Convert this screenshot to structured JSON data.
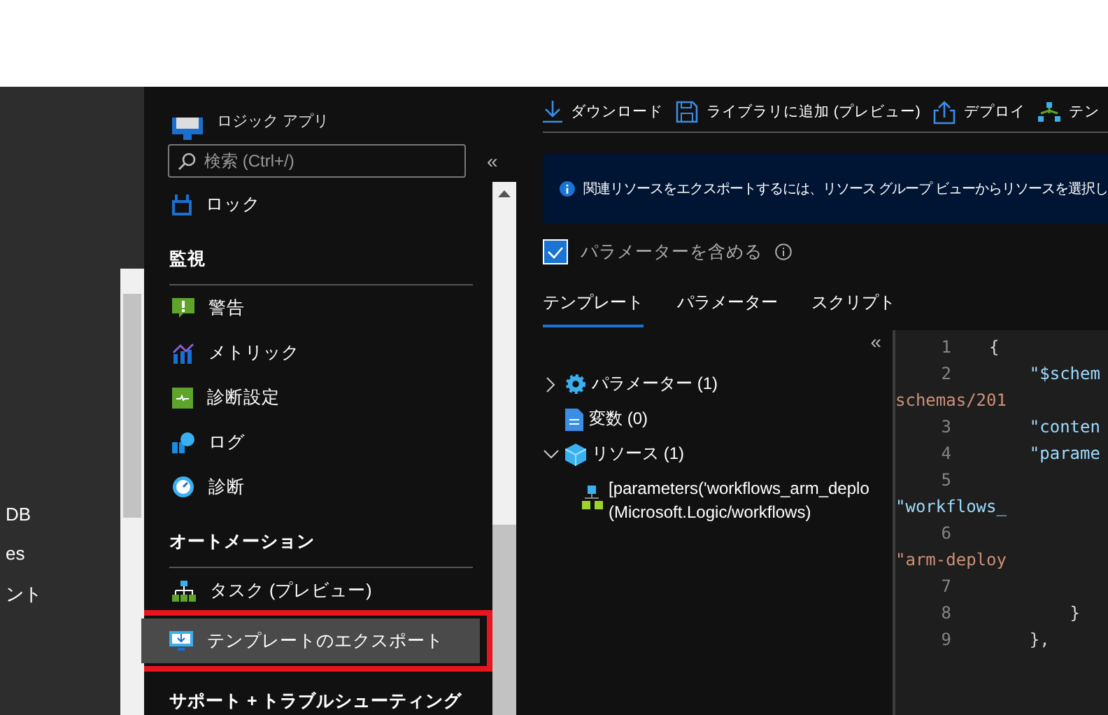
{
  "background_list": [
    {
      "label": "DB"
    },
    {
      "label": "es"
    },
    {
      "label": "ント"
    }
  ],
  "blade": {
    "subtitle": "ロジック アプリ",
    "search": {
      "placeholder": "検索 (Ctrl+/)"
    },
    "collapse": "«",
    "menu": [
      {
        "kind": "item",
        "label": "ロック",
        "selected": false
      },
      {
        "kind": "section",
        "label": "監視"
      },
      {
        "kind": "item",
        "label": "警告",
        "selected": false
      },
      {
        "kind": "item",
        "label": "メトリック",
        "selected": false
      },
      {
        "kind": "item",
        "label": "診断設定",
        "selected": false
      },
      {
        "kind": "item",
        "label": "ログ",
        "selected": false
      },
      {
        "kind": "item",
        "label": "診断",
        "selected": false
      },
      {
        "kind": "section",
        "label": "オートメーション"
      },
      {
        "kind": "item",
        "label": "タスク (プレビュー)",
        "selected": false
      },
      {
        "kind": "item",
        "label": "テンプレートのエクスポート",
        "selected": true
      },
      {
        "kind": "section",
        "label": "サポート + トラブルシューティング"
      }
    ]
  },
  "toolbar": [
    {
      "label": "ダウンロード"
    },
    {
      "label": "ライブラリに追加 (プレビュー)"
    },
    {
      "label": "デプロイ"
    },
    {
      "label": "テン"
    }
  ],
  "banner": {
    "text": "関連リソースをエクスポートするには、リソース グループ ビューからリソースを選択し"
  },
  "include_parameters": {
    "label": "パラメーターを含める",
    "checked": true
  },
  "tabs": [
    {
      "label": "テンプレート",
      "selected": true
    },
    {
      "label": "パラメーター",
      "selected": false
    },
    {
      "label": "スクリプト",
      "selected": false
    }
  ],
  "tree_collapse": "«",
  "tree": [
    {
      "label": "パラメーター (1)",
      "expanded": false
    },
    {
      "label": "変数 (0)"
    },
    {
      "label": "リソース (1)",
      "expanded": true,
      "children": [
        {
          "lines": [
            "[parameters('workflows_arm_deplo",
            "(Microsoft.Logic/workflows)"
          ]
        }
      ]
    }
  ],
  "code_lines": [
    {
      "number": "1",
      "text": "{",
      "kind": "punct"
    },
    {
      "number": "2",
      "text": "    \"$schem",
      "kind": "key"
    },
    {
      "text": "schemas/201",
      "kind": "string"
    },
    {
      "number": "3",
      "text": "    \"conten",
      "kind": "key"
    },
    {
      "number": "4",
      "text": "    \"parame",
      "kind": "key"
    },
    {
      "number": "5"
    },
    {
      "text": "\"workflows_",
      "kind": "key"
    },
    {
      "number": "6"
    },
    {
      "text": "\"arm-deploy",
      "kind": "string"
    },
    {
      "number": "7"
    },
    {
      "number": "8",
      "text": "        }",
      "kind": "punct"
    },
    {
      "number": "9",
      "text": "    },",
      "kind": "punct"
    }
  ]
}
